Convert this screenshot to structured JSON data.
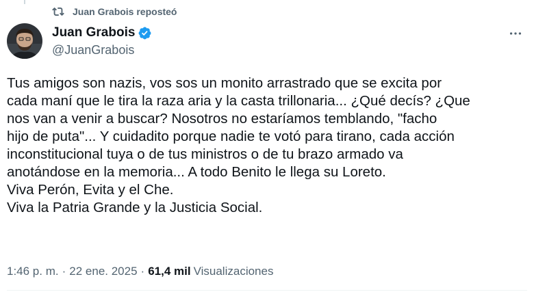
{
  "repost": {
    "text": "Juan Grabois reposteó",
    "icon": "repost-icon"
  },
  "author": {
    "name": "Juan Grabois",
    "handle": "@JuanGrabois",
    "verified": true,
    "verified_color": "#1d9bf0"
  },
  "menu": {
    "icon": "more-options-icon"
  },
  "tweet": {
    "lines": [
      "Tus amigos son nazis, vos sos un monito arrastrado que se excita por",
      "cada maní que le tira la raza aria y la casta trillonaria... ¿Qué decís? ¿Que",
      "nos van a venir a buscar? Nosotros no estaríamos temblando, \"facho",
      "hijo de puta\"... Y cuidadito porque nadie te votó para tirano, cada acción",
      "inconstitucional tuya o de tus ministros o de tu brazo armado va",
      "anotándose en la memoria... A todo Benito le llega su Loreto.",
      "Viva Perón, Evita y el Che.",
      "Viva la Patria Grande y la Justicia Social."
    ]
  },
  "meta": {
    "time": "1:46 p. m.",
    "separator": "·",
    "date": "22 ene. 2025",
    "views_count": "61,4 mil",
    "views_label": "Visualizaciones"
  },
  "colors": {
    "text": "#0f1419",
    "secondary": "#536471",
    "divider": "#eff3f4"
  }
}
